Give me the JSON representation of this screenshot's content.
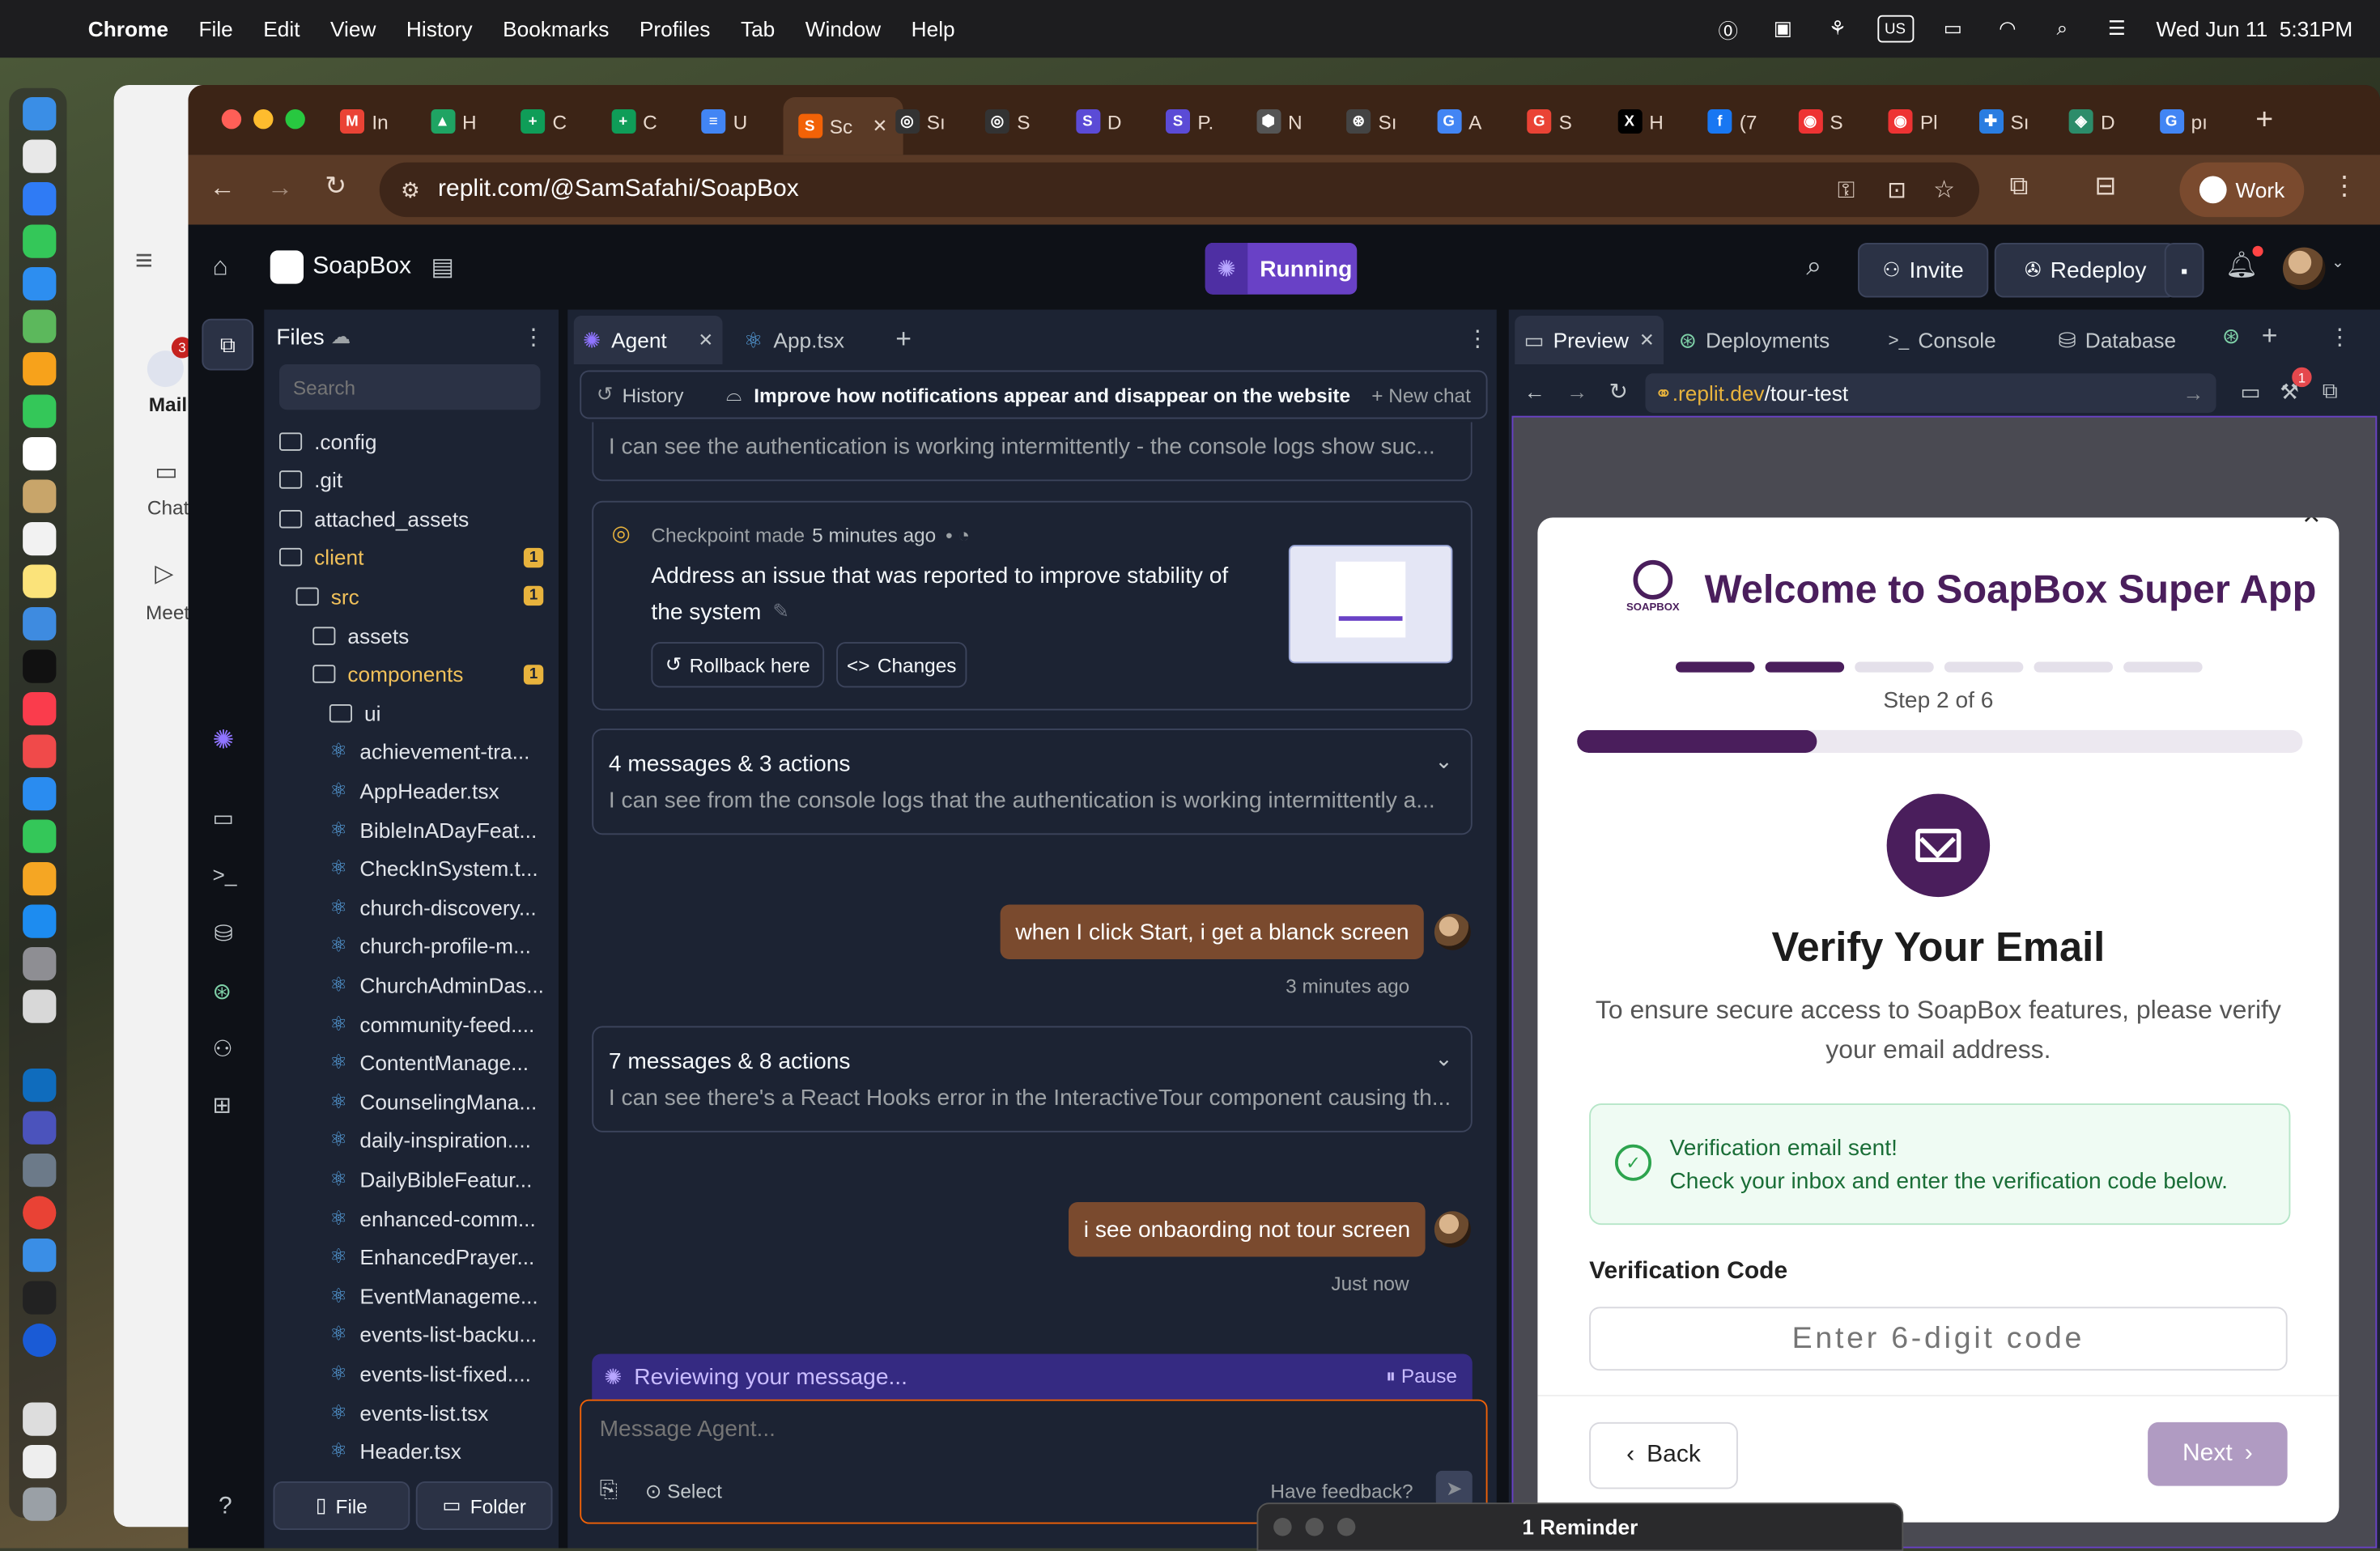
{
  "menubar": {
    "app": "Chrome",
    "items": [
      "File",
      "Edit",
      "View",
      "History",
      "Bookmarks",
      "Profiles",
      "Tab",
      "Window",
      "Help"
    ],
    "datetime": "Wed Jun 11  5:31PM"
  },
  "background_app": {
    "mail_label": "Mail",
    "chat_label": "Chat",
    "meet_label": "Meet",
    "mail_badge": "3"
  },
  "chrome": {
    "tabs": [
      {
        "icon": "M",
        "label": "In",
        "color": "#ea4335"
      },
      {
        "icon": "▲",
        "label": "H",
        "color": "#1fa463"
      },
      {
        "icon": "+",
        "label": "C",
        "color": "#0f9d58"
      },
      {
        "icon": "+",
        "label": "C",
        "color": "#0f9d58"
      },
      {
        "icon": "≡",
        "label": "U",
        "color": "#4285f4"
      },
      {
        "icon": "S",
        "label": "Sc",
        "color": "#f26207",
        "active": true
      },
      {
        "icon": "◎",
        "label": "Sı",
        "color": "#333"
      },
      {
        "icon": "◎",
        "label": "S",
        "color": "#333"
      },
      {
        "icon": "S",
        "label": "D",
        "color": "#5b4bd6"
      },
      {
        "icon": "S",
        "label": "P.",
        "color": "#5b4bd6"
      },
      {
        "icon": "⬢",
        "label": "N",
        "color": "#555"
      },
      {
        "icon": "⊛",
        "label": "Sı",
        "color": "#444"
      },
      {
        "icon": "G",
        "label": "A",
        "color": "#4285f4"
      },
      {
        "icon": "G",
        "label": "S",
        "color": "#ea4335"
      },
      {
        "icon": "X",
        "label": "H",
        "color": "#000"
      },
      {
        "icon": "f",
        "label": "(7",
        "color": "#1877f2"
      },
      {
        "icon": "◉",
        "label": "S",
        "color": "#e33"
      },
      {
        "icon": "◉",
        "label": "Pl",
        "color": "#e33"
      },
      {
        "icon": "✚",
        "label": "Sı",
        "color": "#2a7de1"
      },
      {
        "icon": "◈",
        "label": "D",
        "color": "#2c8c6a"
      },
      {
        "icon": "G",
        "label": "pı",
        "color": "#4285f4"
      }
    ],
    "url": "replit.com/@SamSafahi/SoapBox",
    "profile": "Work"
  },
  "replit": {
    "app_name": "SoapBox",
    "run_status": "Running",
    "invite": "Invite",
    "redeploy": "Redeploy",
    "files": {
      "title": "Files",
      "search_placeholder": "Search",
      "rows": [
        {
          "name": ".config",
          "type": "folder",
          "depth": 0
        },
        {
          "name": ".git",
          "type": "folder",
          "depth": 0
        },
        {
          "name": "attached_assets",
          "type": "folder",
          "depth": 0
        },
        {
          "name": "client",
          "type": "folder",
          "depth": 0,
          "badge": "1",
          "hl": true
        },
        {
          "name": "src",
          "type": "folder",
          "depth": 1,
          "badge": "1",
          "hl": true
        },
        {
          "name": "assets",
          "type": "folder",
          "depth": 2
        },
        {
          "name": "components",
          "type": "folder",
          "depth": 2,
          "badge": "1",
          "hl": true
        },
        {
          "name": "ui",
          "type": "folder",
          "depth": 3
        },
        {
          "name": "achievement-tra...",
          "type": "react",
          "depth": 3
        },
        {
          "name": "AppHeader.tsx",
          "type": "react",
          "depth": 3
        },
        {
          "name": "BibleInADayFeat...",
          "type": "react",
          "depth": 3
        },
        {
          "name": "CheckInSystem.t...",
          "type": "react",
          "depth": 3
        },
        {
          "name": "church-discovery...",
          "type": "react",
          "depth": 3
        },
        {
          "name": "church-profile-m...",
          "type": "react",
          "depth": 3
        },
        {
          "name": "ChurchAdminDas...",
          "type": "react",
          "depth": 3
        },
        {
          "name": "community-feed....",
          "type": "react",
          "depth": 3
        },
        {
          "name": "ContentManage...",
          "type": "react",
          "depth": 3
        },
        {
          "name": "CounselingMana...",
          "type": "react",
          "depth": 3
        },
        {
          "name": "daily-inspiration....",
          "type": "react",
          "depth": 3
        },
        {
          "name": "DailyBibleFeatur...",
          "type": "react",
          "depth": 3
        },
        {
          "name": "enhanced-comm...",
          "type": "react",
          "depth": 3
        },
        {
          "name": "EnhancedPrayer...",
          "type": "react",
          "depth": 3
        },
        {
          "name": "EventManageme...",
          "type": "react",
          "depth": 3
        },
        {
          "name": "events-list-backu...",
          "type": "react",
          "depth": 3
        },
        {
          "name": "events-list-fixed....",
          "type": "react",
          "depth": 3
        },
        {
          "name": "events-list.tsx",
          "type": "react",
          "depth": 3
        },
        {
          "name": "Header.tsx",
          "type": "react",
          "depth": 3
        }
      ],
      "new_file": "File",
      "new_folder": "Folder"
    },
    "agent": {
      "tab_agent": "Agent",
      "tab_file": "App.tsx",
      "history": "History",
      "chat_title": "Improve how notifications appear and disappear on the website",
      "new_chat": "New chat",
      "top_snippet": "I can see the authentication is working intermittently - the console logs show suc...",
      "checkpoint_label": "Checkpoint made",
      "checkpoint_time": "5 minutes ago",
      "checkpoint_text_1": "Address an issue that was reported to improve stability of",
      "checkpoint_text_2": "the system",
      "rollback": "Rollback here",
      "changes": "Changes",
      "group1_title": "4 messages & 3 actions",
      "group1_text": "I can see from the console logs that the authentication is working intermittently a...",
      "user_msg1": "when I click Start, i get a blanck screen",
      "user_msg1_time": "3 minutes ago",
      "group2_title": "7 messages & 8 actions",
      "group2_text": "I can see there's a React Hooks error in the InteractiveTour component causing th...",
      "user_msg2": "i see onbaording not tour screen",
      "user_msg2_time": "Just now",
      "status": "Reviewing your message...",
      "pause": "Pause",
      "input_placeholder": "Message Agent...",
      "select": "Select",
      "feedback": "Have feedback?"
    },
    "preview": {
      "tabs": [
        "Preview",
        "Deployments",
        "Console",
        "Database"
      ],
      "url_prefix": ".replit.dev",
      "url_path": "/tour-test",
      "notif_count": "1",
      "logo_text": "SOAPBOX",
      "modal_title": "Welcome to SoapBox Super App",
      "step_text": "Step 2 of 6",
      "steps_total": 6,
      "steps_done": 2,
      "progress_fraction": 0.33,
      "heading": "Verify Your Email",
      "subtext": "To ensure secure access to SoapBox features, please verify your email address.",
      "alert_title": "Verification email sent!",
      "alert_text": "Check your inbox and enter the verification code below.",
      "code_label": "Verification Code",
      "code_placeholder": "Enter 6-digit code",
      "back": "Back",
      "next": "Next"
    }
  },
  "reminder": "1 Reminder",
  "colors": {
    "brand_purple": "#4a1e5c",
    "replit_bg": "#0e1117",
    "panel_bg": "#1c2333",
    "chrome_tab_brown": "#3c2416",
    "accent_orange": "#f26207",
    "success_green": "#2da44e"
  }
}
